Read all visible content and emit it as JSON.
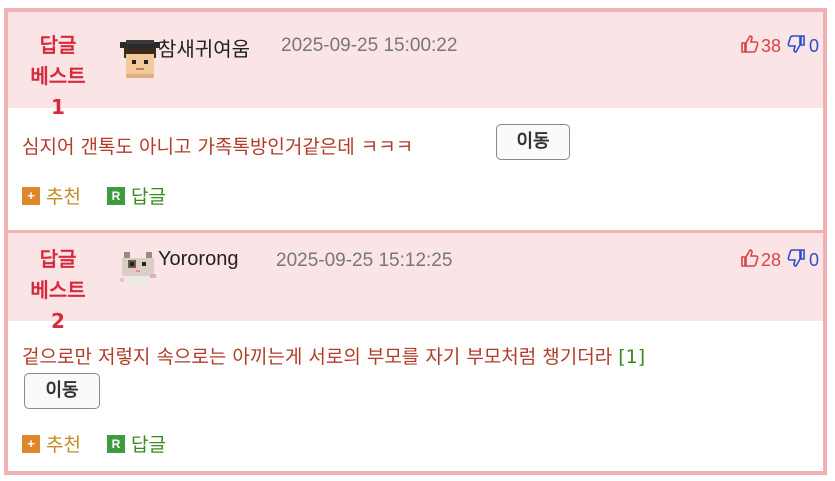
{
  "comments": [
    {
      "best_line1": "답글",
      "best_line2": "베스트1",
      "username": "참새귀여움",
      "avatar_icon": "pixel-character-avatar",
      "datetime": "2025-09-25 15:00:22",
      "upvotes": "38",
      "downvotes": "0",
      "text": "심지어 갠톡도 아니고 가족톡방인거같은데 ㅋㅋㅋ",
      "reference": "",
      "move_label": "이동",
      "recommend_label": "추천",
      "reply_label": "답글",
      "recommend_badge": "+",
      "reply_badge": "R"
    },
    {
      "best_line1": "답글",
      "best_line2": "베스트2",
      "username": "Yororong",
      "avatar_icon": "pixel-cat-avatar",
      "datetime": "2025-09-25 15:12:25",
      "upvotes": "28",
      "downvotes": "0",
      "text": "겉으로만 저렇지 속으로는 아끼는게 서로의 부모를 자기 부모처럼 챙기더라",
      "reference": "[1]",
      "move_label": "이동",
      "recommend_label": "추천",
      "reply_label": "답글",
      "recommend_badge": "+",
      "reply_badge": "R"
    }
  ],
  "colors": {
    "header_bg": "#fbe4e6",
    "border": "#f0b2b2",
    "best_label": "#d62b3c",
    "comment_text": "#b23c28",
    "upvote": "#d64545",
    "downvote": "#2b4fc7"
  }
}
